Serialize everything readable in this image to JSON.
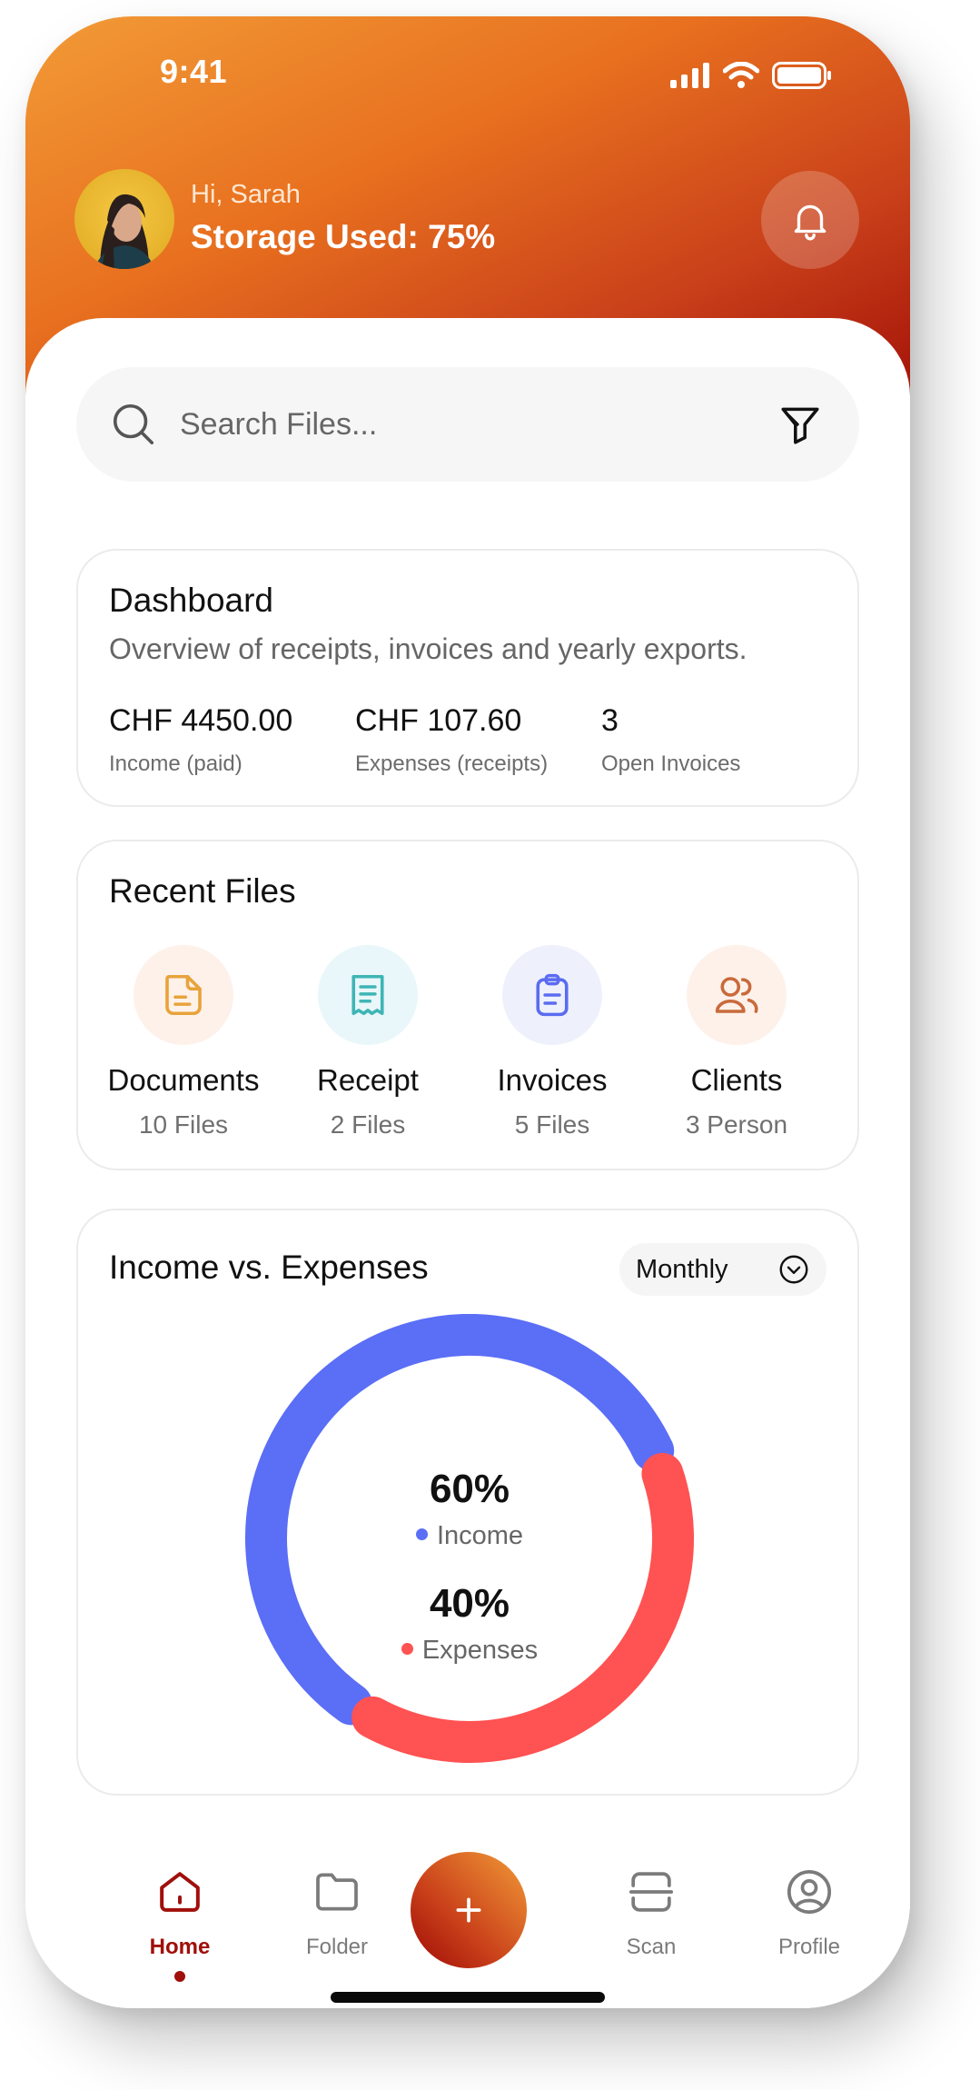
{
  "status_bar": {
    "time": "9:41"
  },
  "header": {
    "greeting": "Hi, Sarah",
    "storage": "Storage Used: 75%"
  },
  "search": {
    "placeholder": "Search Files..."
  },
  "dashboard": {
    "title": "Dashboard",
    "subtitle": "Overview of receipts, invoices and yearly exports.",
    "stats": [
      {
        "value": "CHF 4450.00",
        "label": "Income (paid)"
      },
      {
        "value": "CHF 107.60",
        "label": "Expenses (receipts)"
      },
      {
        "value": "3",
        "label": "Open Invoices"
      }
    ]
  },
  "recent_files": {
    "title": "Recent Files",
    "items": [
      {
        "name": "Documents",
        "count": "10 Files",
        "icon": "document-icon",
        "color": "#e8a33a",
        "bg": "#fdf1ea"
      },
      {
        "name": "Receipt",
        "count": "2 Files",
        "icon": "receipt-icon",
        "color": "#3fb5b5",
        "bg": "#e9f7fa"
      },
      {
        "name": "Invoices",
        "count": "5 Files",
        "icon": "clipboard-icon",
        "color": "#5b6cf0",
        "bg": "#eef1fc"
      },
      {
        "name": "Clients",
        "count": "3 Person",
        "icon": "users-icon",
        "color": "#c96a3b",
        "bg": "#fdf1ea"
      }
    ]
  },
  "income_expenses": {
    "title": "Income vs. Expenses",
    "period": "Monthly"
  },
  "chart_data": {
    "type": "pie",
    "title": "Income vs. Expenses",
    "series": [
      {
        "name": "Income",
        "value": 60,
        "label": "60%",
        "color": "#5b6ef6"
      },
      {
        "name": "Expenses",
        "value": 40,
        "label": "40%",
        "color": "#ff5252"
      }
    ]
  },
  "nav": {
    "items": [
      {
        "label": "Home",
        "icon": "home-icon",
        "active": true
      },
      {
        "label": "Folder",
        "icon": "folder-icon",
        "active": false
      },
      {
        "label": "Scan",
        "icon": "scan-icon",
        "active": false
      },
      {
        "label": "Profile",
        "icon": "profile-icon",
        "active": false
      }
    ],
    "add_icon": "plus-icon"
  },
  "colors": {
    "accent": "#a00f0a",
    "header_start": "#f29b37",
    "header_end": "#9e0b05"
  }
}
